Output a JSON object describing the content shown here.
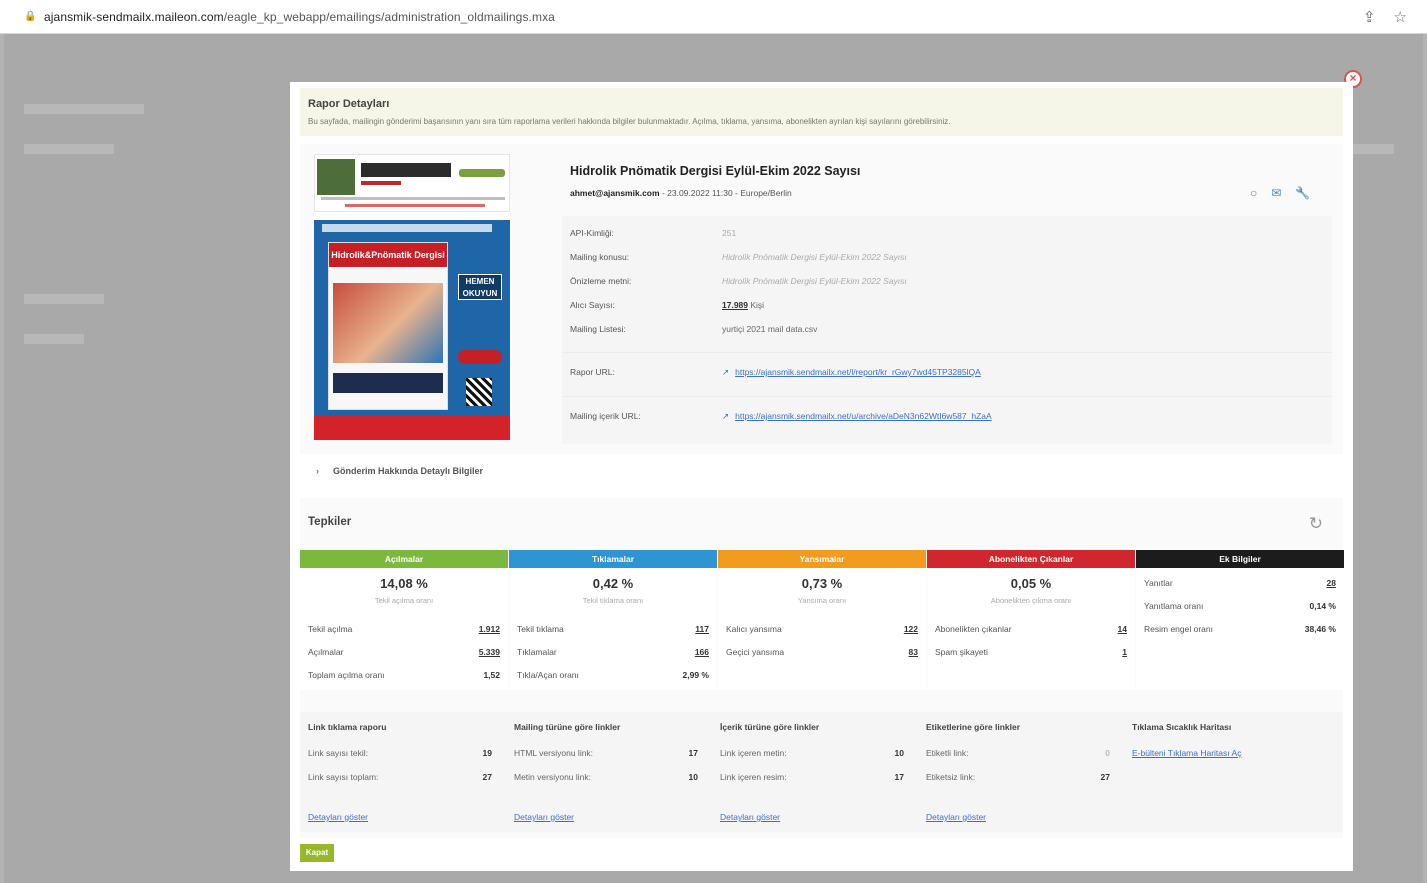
{
  "browser": {
    "url_host": "ajansmik-sendmailx.maileon.com",
    "url_path": "/eagle_kp_webapp/emailings/administration_oldmailings.mxa"
  },
  "report": {
    "title": "Rapor Detayları",
    "intro": "Bu sayfada, mailingin gönderimi başarısının yanı sıra tüm raporlama verileri hakkında bilgiler bulunmaktadır. Açılma, tıklama, yansıma, abonelikten ayrılan kişi sayılarını görebilirsiniz."
  },
  "mailing": {
    "title": "Hidrolik Pnömatik Dergisi Eylül-Ekim 2022 Sayısı",
    "sender": "ahmet@ajansmik.com",
    "date": "23.09.2022 11:30",
    "timezone": "Europe/Berlin",
    "magazine_title": "Hidrolik&Pnömatik Dergisi",
    "read_button": "HEMEN OKUYUN"
  },
  "props": {
    "api_label": "API-Kimliği:",
    "api_value": "251",
    "subject_label": "Mailing konusu:",
    "subject_value": "Hidrolik Pnömatik Dergisi Eylül-Ekim 2022 Sayısı",
    "preview_label": "Önizleme metni:",
    "preview_value": "Hidrolik Pnömatik Dergisi Eylül-Ekim 2022 Sayısı",
    "recipients_label": "Alıcı Sayısı:",
    "recipients_value": "17.989",
    "recipients_unit": "Kişi",
    "list_label": "Mailing Listesi:",
    "list_value": "yurtiçi 2021 mail data.csv",
    "report_url_label": "Rapor URL:",
    "report_url": "https://ajansmik.sendmailx.net/l/report/kr_rGwy7wd45TP3285lQA",
    "content_url_label": "Mailing içerik URL:",
    "content_url": "https://ajansmik.sendmailx.net/u/archive/aDeN3n62WtI6w587_hZaA"
  },
  "details_toggle": "Gönderim Hakkında Detaylı Bilgiler",
  "reactions": {
    "title": "Tepkiler",
    "columns": [
      {
        "head": "Açılmalar",
        "color": "#7cb83e",
        "main": "14,08 %",
        "sub": "Tekil açılma oranı",
        "rows": [
          [
            "Tekil açılma",
            "1.912"
          ],
          [
            "Açılmalar",
            "5.339"
          ],
          [
            "Toplam açılma oranı",
            "1,52"
          ]
        ]
      },
      {
        "head": "Tıklamalar",
        "color": "#2e94d2",
        "main": "0,42 %",
        "sub": "Tekil tıklama oranı",
        "rows": [
          [
            "Tekil tıklama",
            "117"
          ],
          [
            "Tıklamalar",
            "166"
          ],
          [
            "Tıkla/Açan oranı",
            "2,99 %"
          ]
        ]
      },
      {
        "head": "Yansımalar",
        "color": "#f29c1f",
        "main": "0,73 %",
        "sub": "Yansıma oranı",
        "rows": [
          [
            "Kalıcı yansıma",
            "122"
          ],
          [
            "Geçici yansıma",
            "83"
          ]
        ]
      },
      {
        "head": "Abonelikten Çıkanlar",
        "color": "#d0272e",
        "main": "0,05 %",
        "sub": "Abonelikten çıkma oranı",
        "rows": [
          [
            "Abonelikten çıkanlar",
            "14"
          ],
          [
            "Spam şikayeti",
            "1"
          ]
        ]
      },
      {
        "head": "Ek Bilgiler",
        "color": "#1c1c1c",
        "main": "",
        "sub": "",
        "rows": [
          [
            "Yanıtlar",
            "28"
          ],
          [
            "Yanıtlama oranı",
            "0,14 %"
          ],
          [
            "Resim engel oranı",
            "38,46 %"
          ]
        ]
      }
    ]
  },
  "subreports": [
    {
      "title": "Link tıklama raporu",
      "rows": [
        [
          "Link sayısı tekil:",
          "19"
        ],
        [
          "Link sayısı toplam:",
          "27"
        ]
      ],
      "link": "Detayları göster"
    },
    {
      "title": "Mailing türüne göre linkler",
      "rows": [
        [
          "HTML versiyonu link:",
          "17"
        ],
        [
          "Metin versiyonu link:",
          "10"
        ]
      ],
      "link": "Detayları göster"
    },
    {
      "title": "İçerik türüne göre linkler",
      "rows": [
        [
          "Link içeren metin:",
          "10"
        ],
        [
          "Link içeren resim:",
          "17"
        ]
      ],
      "link": "Detayları göster"
    },
    {
      "title": "Etiketlerine göre linkler",
      "rows": [
        [
          "Etiketli link:",
          "0"
        ],
        [
          "Etiketsiz link:",
          "27"
        ]
      ],
      "link": "Detayları göster"
    },
    {
      "title": "Tıklama Sıcaklık Haritası",
      "rows": [],
      "link": "E-bülteni Tıklama Haritası Aç"
    }
  ],
  "close_button": "Kapat"
}
